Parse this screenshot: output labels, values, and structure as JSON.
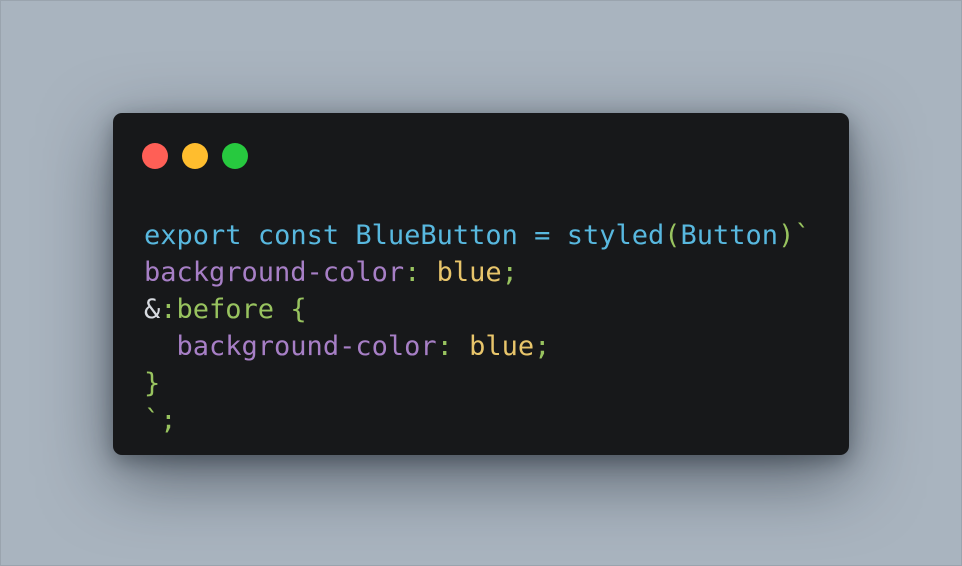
{
  "colors": {
    "background": "#a9b4bf",
    "editor_bg": "#17181a",
    "close_dot": "#ff5f56",
    "minimize_dot": "#ffbd2e",
    "maximize_dot": "#27c93f",
    "keyword": "#58b8df",
    "property": "#a77fc6",
    "value": "#e8c56b",
    "punctuation": "#98c35f",
    "plain": "#d7dae0"
  },
  "window_controls": [
    "close",
    "minimize",
    "maximize"
  ],
  "code": {
    "line1": {
      "export": "export",
      "sp1": " ",
      "const": "const",
      "sp2": " ",
      "name": "BlueButton",
      "eq": " = ",
      "styled": "styled",
      "paren_open": "(",
      "arg": "Button",
      "paren_close": ")",
      "backtick": "`"
    },
    "line2": {
      "prop": "background-color",
      "colon": ": ",
      "value": "blue",
      "semi": ";"
    },
    "line3": {
      "amp": "&",
      "selector": ":before",
      "brace": " {"
    },
    "line4": {
      "indent": "  ",
      "prop": "background-color",
      "colon": ": ",
      "value": "blue",
      "semi": ";"
    },
    "line5": {
      "brace": "}"
    },
    "line6": {
      "backtick": "`",
      "semi": ";"
    }
  }
}
